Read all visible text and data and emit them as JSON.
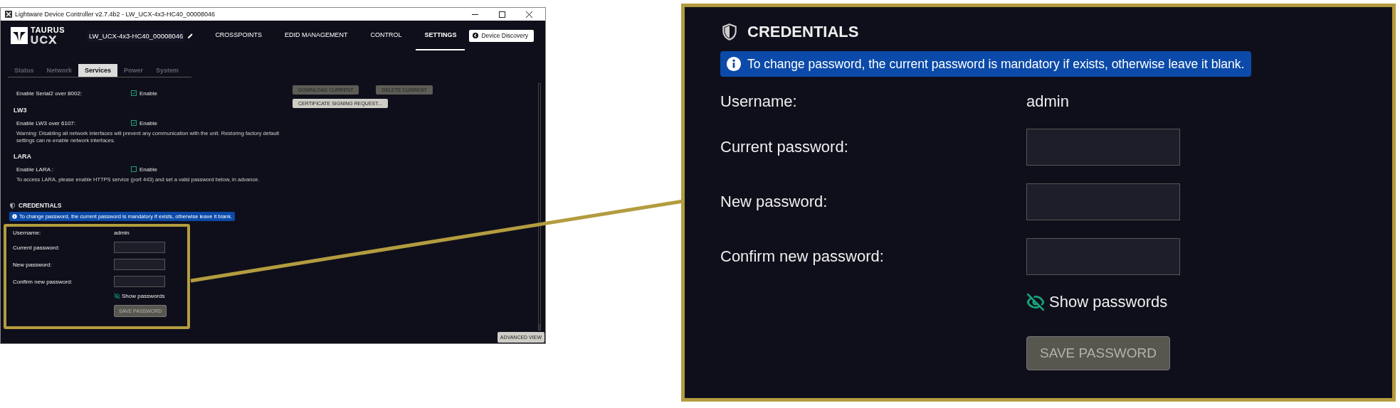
{
  "window": {
    "title": "Lightware Device Controller v2.7.4b2 - LW_UCX-4x3-HC40_00008046"
  },
  "header": {
    "logo_top": "TAURUS",
    "logo_bottom": "UCX",
    "device_name": "LW_UCX-4x3-HC40_00008046",
    "nav": [
      {
        "label": "CROSSPOINTS",
        "selected": false
      },
      {
        "label": "EDID MANAGEMENT",
        "selected": false
      },
      {
        "label": "CONTROL",
        "selected": false
      },
      {
        "label": "SETTINGS",
        "selected": true
      }
    ],
    "discovery_button": "Device Discovery"
  },
  "subtabs": [
    {
      "label": "Status",
      "selected": false
    },
    {
      "label": "Network",
      "selected": false
    },
    {
      "label": "Services",
      "selected": true
    },
    {
      "label": "Power",
      "selected": false
    },
    {
      "label": "System",
      "selected": false
    }
  ],
  "services": [
    {
      "label": "Enable Serial2 over 8002:",
      "option": "Enable",
      "checked": true
    },
    {
      "heading": "LW3",
      "label": "Enable LW3 over 6107:",
      "option": "Enable",
      "checked": true,
      "note": "Warning: Disabling all network interfaces will prevent any communication with the unit. Restoring factory default settings can re-enable network interfaces."
    },
    {
      "heading": "LARA",
      "label": "Enable LARA :",
      "option": "Enable",
      "checked": false,
      "note": "To access LARA, please enable HTTPS service (port 443) and set a valid password below, in advance."
    }
  ],
  "certificate_buttons": [
    {
      "label": "DOWNLOAD CURRENT",
      "disabled": true
    },
    {
      "label": "DELETE CURRENT",
      "disabled": true
    },
    {
      "label": "CERTIFICATE SIGNING REQUEST...",
      "disabled": false
    }
  ],
  "credentials": {
    "title": "CREDENTIALS",
    "info": "To change password, the current password is mandatory if exists, otherwise leave it blank.",
    "username_label": "Username:",
    "username": "admin",
    "fields": [
      {
        "label": "Current password:"
      },
      {
        "label": "New password:"
      },
      {
        "label": "Confirm new password:"
      }
    ],
    "show_passwords": "Show passwords",
    "save_button": {
      "label": "SAVE PASSWORD",
      "disabled": true
    }
  },
  "advanced_view": "ADVANCED VIEW",
  "callout": {
    "title": "CREDENTIALS",
    "info": "To change password, the current password is mandatory if exists, otherwise leave it blank.",
    "username_label": "Username:",
    "username": "admin",
    "fields": [
      {
        "label": "Current password:"
      },
      {
        "label": "New password:"
      },
      {
        "label": "Confirm new password:"
      }
    ],
    "show_passwords": "Show passwords",
    "save_button": {
      "label": "SAVE PASSWORD",
      "disabled": true
    }
  }
}
